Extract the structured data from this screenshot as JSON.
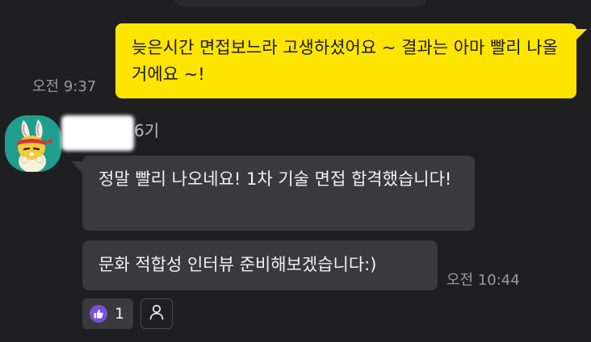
{
  "colors": {
    "background": "#1f1f21",
    "my_bubble": "#fee500",
    "their_bubble": "#3a3a3c",
    "avatar_bg": "#1f9e8e",
    "like_icon": "#7b4fe0"
  },
  "messages": {
    "mine": {
      "text": "늦은시간 면접보느라 고생하셨어요 ~ 결과는 아마 빨리 나올거에요 ~!",
      "time": "오전 9:37"
    },
    "sender": {
      "name_suffix": "6기",
      "avatar_icon": "rabbit-avatar-icon"
    },
    "theirs": [
      {
        "text": "정말 빨리 나오네요! 1차 기술 면접 합격했습니다!"
      },
      {
        "text": "문화 적합성 인터뷰 준비해보겠습니다:)"
      }
    ],
    "theirs_time": "오전 10:44"
  },
  "reactions": {
    "like_icon": "thumbs-up-icon",
    "like_count": "1",
    "add_icon": "person-icon"
  }
}
